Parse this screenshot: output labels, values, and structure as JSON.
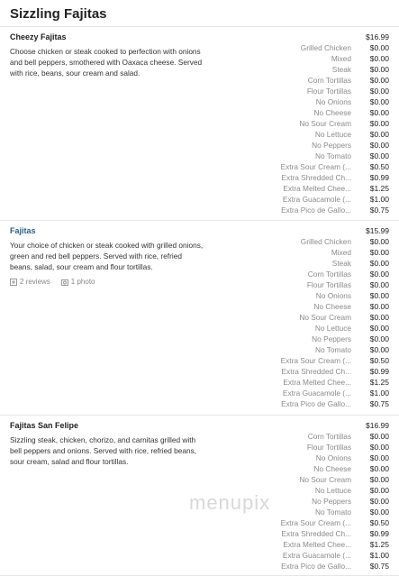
{
  "section_title": "Sizzling Fajitas",
  "items": [
    {
      "name": "Cheezy Fajitas",
      "description": "Choose chicken or steak cooked to perfection with onions and bell peppers, smothered with Oaxaca cheese. Served with rice, beans, sour cream and salad.",
      "base_price": "$16.99",
      "options": [
        {
          "label": "Grilled Chicken",
          "price": "$0.00"
        },
        {
          "label": "Mixed",
          "price": "$0.00"
        },
        {
          "label": "Steak",
          "price": "$0.00"
        },
        {
          "label": "Corn Tortillas",
          "price": "$0.00"
        },
        {
          "label": "Flour Tortillas",
          "price": "$0.00"
        },
        {
          "label": "No Onions",
          "price": "$0.00"
        },
        {
          "label": "No Cheese",
          "price": "$0.00"
        },
        {
          "label": "No Sour Cream",
          "price": "$0.00"
        },
        {
          "label": "No Lettuce",
          "price": "$0.00"
        },
        {
          "label": "No Peppers",
          "price": "$0.00"
        },
        {
          "label": "No Tomato",
          "price": "$0.00"
        },
        {
          "label": "Extra Sour Cream (...",
          "price": "$0.50"
        },
        {
          "label": "Extra Shredded Ch...",
          "price": "$0.99"
        },
        {
          "label": "Extra Melted Chee...",
          "price": "$1.25"
        },
        {
          "label": "Extra Guacamole (...",
          "price": "$1.00"
        },
        {
          "label": "Extra Pico de Gallo...",
          "price": "$0.75"
        }
      ]
    },
    {
      "name": "Fajitas",
      "description": "Your choice of chicken or steak cooked with grilled onions, green and red bell peppers. Served with rice, refried beans, salad, sour cream and flour tortillas.",
      "reviews": "2 reviews",
      "photos": "1 photo",
      "base_price": "$15.99",
      "options": [
        {
          "label": "Grilled Chicken",
          "price": "$0.00"
        },
        {
          "label": "Mixed",
          "price": "$0.00"
        },
        {
          "label": "Steak",
          "price": "$0.00"
        },
        {
          "label": "Corn Tortillas",
          "price": "$0.00"
        },
        {
          "label": "Flour Tortillas",
          "price": "$0.00"
        },
        {
          "label": "No Onions",
          "price": "$0.00"
        },
        {
          "label": "No Cheese",
          "price": "$0.00"
        },
        {
          "label": "No Sour Cream",
          "price": "$0.00"
        },
        {
          "label": "No Lettuce",
          "price": "$0.00"
        },
        {
          "label": "No Peppers",
          "price": "$0.00"
        },
        {
          "label": "No Tomato",
          "price": "$0.00"
        },
        {
          "label": "Extra Sour Cream (...",
          "price": "$0.50"
        },
        {
          "label": "Extra Shredded Ch...",
          "price": "$0.99"
        },
        {
          "label": "Extra Melted Chee...",
          "price": "$1.25"
        },
        {
          "label": "Extra Guacamole (...",
          "price": "$1.00"
        },
        {
          "label": "Extra Pico de Gallo...",
          "price": "$0.75"
        }
      ]
    },
    {
      "name": "Fajitas San Felipe",
      "description": "Sizzling steak, chicken, chorizo, and carnitas grilled with bell peppers and onions. Served with rice, refried beans, sour cream, salad and flour tortillas.",
      "base_price": "$16.99",
      "options": [
        {
          "label": "Corn Tortillas",
          "price": "$0.00"
        },
        {
          "label": "Flour Tortillas",
          "price": "$0.00"
        },
        {
          "label": "No Onions",
          "price": "$0.00"
        },
        {
          "label": "No Cheese",
          "price": "$0.00"
        },
        {
          "label": "No Sour Cream",
          "price": "$0.00"
        },
        {
          "label": "No Lettuce",
          "price": "$0.00"
        },
        {
          "label": "No Peppers",
          "price": "$0.00"
        },
        {
          "label": "No Tomato",
          "price": "$0.00"
        },
        {
          "label": "Extra Sour Cream (...",
          "price": "$0.50"
        },
        {
          "label": "Extra Shredded Ch...",
          "price": "$0.99"
        },
        {
          "label": "Extra Melted Chee...",
          "price": "$1.25"
        },
        {
          "label": "Extra Guacamole (...",
          "price": "$1.00"
        },
        {
          "label": "Extra Pico de Gallo...",
          "price": "$0.75"
        }
      ]
    }
  ],
  "watermark": "menupix",
  "colors": {
    "link": "#2c5f8a",
    "muted": "#8a8a8a",
    "divider": "#e6e6e6"
  }
}
